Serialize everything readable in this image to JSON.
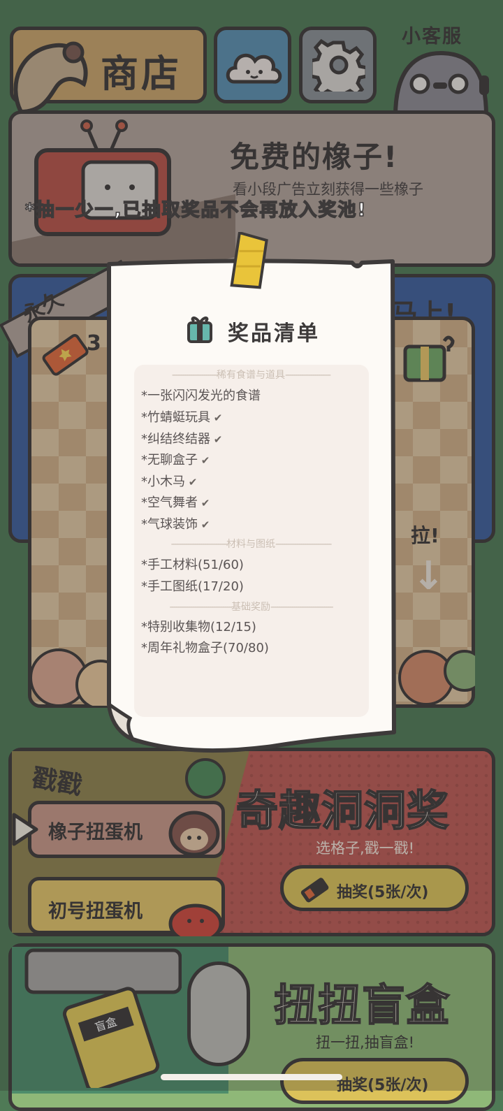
{
  "header": {
    "shop_label": "商店",
    "support_label": "小客服"
  },
  "free_acorns": {
    "title": "免费的橡子!",
    "subtitle": "看小段广告立刻获得一些橡子"
  },
  "notice": "*抽一少一,已抽取奖品不会再放入奖池!",
  "machine_panel": {
    "banner_left": "永久",
    "banner_right": "马上!",
    "ticket_count": "3",
    "pull_label": "拉!",
    "pull_arrow": "↓"
  },
  "prize_list": {
    "title": "奖品清单",
    "sections": [
      {
        "header": "稀有食谱与道具",
        "items": [
          {
            "text": "*一张闪闪发光的食谱",
            "claimed": false
          },
          {
            "text": "*竹蜻蜓玩具",
            "claimed": true
          },
          {
            "text": "*纠结终结器",
            "claimed": true
          },
          {
            "text": "*无聊盒子",
            "claimed": true
          },
          {
            "text": "*小木马",
            "claimed": true
          },
          {
            "text": "*空气舞者",
            "claimed": true
          },
          {
            "text": "*气球装饰",
            "claimed": true
          }
        ]
      },
      {
        "header": "材料与图纸",
        "items": [
          {
            "text": "*手工材料(51/60)",
            "claimed": false
          },
          {
            "text": "*手工图纸(17/20)",
            "claimed": false
          }
        ]
      },
      {
        "header": "基础奖励",
        "items": [
          {
            "text": "*特别收集物(12/15)",
            "claimed": false
          },
          {
            "text": "*周年礼物盒子(70/80)",
            "claimed": false
          }
        ]
      }
    ]
  },
  "hole_prize": {
    "corner_label": "戳戳",
    "machine1": "橡子扭蛋机",
    "machine2": "初号扭蛋机",
    "title": "奇趣洞洞奖",
    "subtitle": "选格子,戳一戳!",
    "draw_button": "抽奖(5张/次)"
  },
  "blind_box": {
    "title": "扭扭盲盒",
    "subtitle": "扭一扭,抽盲盒!",
    "draw_button": "抽奖(5张/次)",
    "box_label": "盲盒"
  },
  "colors": {
    "background": "#4f7a56",
    "outline": "#3d3a3a",
    "shop": "#c9a46b",
    "cloud_btn": "#5a8fb0",
    "gear_btn": "#8a8f95",
    "free_card": "#b2a39a",
    "hole_card": "#bd5b55",
    "blind_card": "#8fb878",
    "paper": "#fdfaf6",
    "button_gold": "#dcc25a"
  }
}
